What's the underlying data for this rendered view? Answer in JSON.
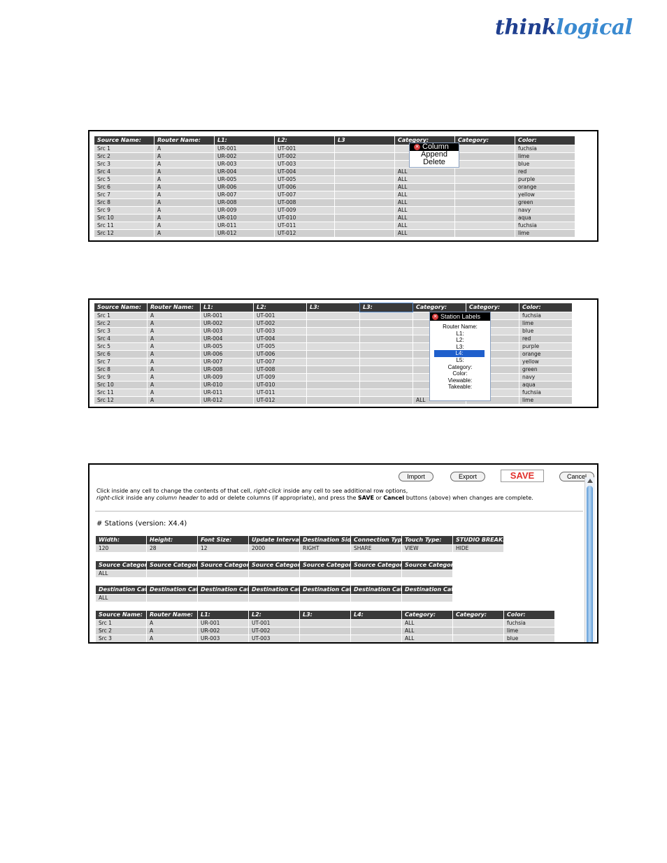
{
  "brand": {
    "part1": "think",
    "part2": "logical"
  },
  "screen1": {
    "headers": [
      "Source Name:",
      "Router Name:",
      "L1:",
      "L2:",
      "L3",
      "Category:",
      "Category:",
      "Color:"
    ],
    "rows": [
      [
        "Src 1",
        "A",
        "UR-001",
        "UT-001",
        "",
        "",
        "",
        "fuchsia"
      ],
      [
        "Src 2",
        "A",
        "UR-002",
        "UT-002",
        "",
        "",
        "",
        "lime"
      ],
      [
        "Src 3",
        "A",
        "UR-003",
        "UT-003",
        "",
        "",
        "",
        "blue"
      ],
      [
        "Src 4",
        "A",
        "UR-004",
        "UT-004",
        "",
        "ALL",
        "",
        "red"
      ],
      [
        "Src 5",
        "A",
        "UR-005",
        "UT-005",
        "",
        "ALL",
        "",
        "purple"
      ],
      [
        "Src 6",
        "A",
        "UR-006",
        "UT-006",
        "",
        "ALL",
        "",
        "orange"
      ],
      [
        "Src 7",
        "A",
        "UR-007",
        "UT-007",
        "",
        "ALL",
        "",
        "yellow"
      ],
      [
        "Src 8",
        "A",
        "UR-008",
        "UT-008",
        "",
        "ALL",
        "",
        "green"
      ],
      [
        "Src 9",
        "A",
        "UR-009",
        "UT-009",
        "",
        "ALL",
        "",
        "navy"
      ],
      [
        "Src 10",
        "A",
        "UR-010",
        "UT-010",
        "",
        "ALL",
        "",
        "aqua"
      ],
      [
        "Src 11",
        "A",
        "UR-011",
        "UT-011",
        "",
        "ALL",
        "",
        "fuchsia"
      ],
      [
        "Src 12",
        "A",
        "UR-012",
        "UT-012",
        "",
        "ALL",
        "",
        "lime"
      ]
    ],
    "context_menu": {
      "title": "Column",
      "items": [
        "Append",
        "Delete"
      ]
    }
  },
  "screen2": {
    "headers": [
      "Source Name:",
      "Router Name:",
      "L1:",
      "L2:",
      "L3:",
      "L3:",
      "Category:",
      "Category:",
      "Color:"
    ],
    "rows": [
      [
        "Src 1",
        "A",
        "UR-001",
        "UT-001",
        "",
        "",
        "",
        "",
        "fuchsia"
      ],
      [
        "Src 2",
        "A",
        "UR-002",
        "UT-002",
        "",
        "",
        "",
        "",
        "lime"
      ],
      [
        "Src 3",
        "A",
        "UR-003",
        "UT-003",
        "",
        "",
        "",
        "",
        "blue"
      ],
      [
        "Src 4",
        "A",
        "UR-004",
        "UT-004",
        "",
        "",
        "",
        "",
        "red"
      ],
      [
        "Src 5",
        "A",
        "UR-005",
        "UT-005",
        "",
        "",
        "",
        "",
        "purple"
      ],
      [
        "Src 6",
        "A",
        "UR-006",
        "UT-006",
        "",
        "",
        "",
        "",
        "orange"
      ],
      [
        "Src 7",
        "A",
        "UR-007",
        "UT-007",
        "",
        "",
        "",
        "",
        "yellow"
      ],
      [
        "Src 8",
        "A",
        "UR-008",
        "UT-008",
        "",
        "",
        "",
        "",
        "green"
      ],
      [
        "Src 9",
        "A",
        "UR-009",
        "UT-009",
        "",
        "",
        "",
        "",
        "navy"
      ],
      [
        "Src 10",
        "A",
        "UR-010",
        "UT-010",
        "",
        "",
        "",
        "",
        "aqua"
      ],
      [
        "Src 11",
        "A",
        "UR-011",
        "UT-011",
        "",
        "",
        "",
        "",
        "fuchsia"
      ],
      [
        "Src 12",
        "A",
        "UR-012",
        "UT-012",
        "",
        "",
        "ALL",
        "",
        "lime"
      ]
    ],
    "context_menu": {
      "title": "Station Labels",
      "items": [
        "Router Name:",
        "L1:",
        "L2:",
        "L3:",
        "L4:",
        "L5:",
        "Category:",
        "Color:",
        "Viewable:",
        "Takeable:"
      ],
      "selected": "L4:"
    }
  },
  "screen3": {
    "buttons": {
      "import": "Import",
      "export": "Export",
      "save": "SAVE",
      "cancel": "Cancel"
    },
    "instructions": {
      "l1a": "Click inside any cell to change the contents of that cell, ",
      "l1b": "right-click",
      "l1c": " inside any cell to see additional row options,",
      "l2a": "right-click",
      "l2b": " inside any ",
      "l2c": "column header",
      "l2d": " to add or delete columns (if appropriate), and press the ",
      "l2e": "SAVE",
      "l2f": " or ",
      "l2g": "Cancel",
      "l2h": " buttons (above) when changes are complete."
    },
    "stations_title": "# Stations (version: X4.4)",
    "settings": {
      "headers": [
        "Width:",
        "Height:",
        "Font Size:",
        "Update Interval:",
        "Destination Side:",
        "Connection Type:",
        "Touch Type:",
        "STUDIO BREAK:"
      ],
      "values": [
        "120",
        "28",
        "12",
        "2000",
        "RIGHT",
        "SHARE",
        "VIEW",
        "HIDE"
      ]
    },
    "source_categories": {
      "headers": [
        "Source Category:",
        "Source Category:",
        "Source Category:",
        "Source Category:",
        "Source Category:",
        "Source Category:",
        "Source Category:"
      ],
      "values": [
        "ALL",
        "",
        "",
        "",
        "",
        "",
        ""
      ]
    },
    "destination_categories": {
      "headers": [
        "Destination Category:",
        "Destination Category:",
        "Destination Category:",
        "Destination Category:",
        "Destination Category:",
        "Destination Category:",
        "Destination Category:"
      ],
      "values": [
        "ALL",
        "",
        "",
        "",
        "",
        "",
        ""
      ]
    },
    "sources": {
      "headers": [
        "Source Name:",
        "Router Name:",
        "L1:",
        "L2:",
        "L3:",
        "L4:",
        "Category:",
        "Category:",
        "Color:"
      ],
      "rows": [
        [
          "Src 1",
          "A",
          "UR-001",
          "UT-001",
          "",
          "",
          "ALL",
          "",
          "fuchsia"
        ],
        [
          "Src 2",
          "A",
          "UR-002",
          "UT-002",
          "",
          "",
          "ALL",
          "",
          "lime"
        ],
        [
          "Src 3",
          "A",
          "UR-003",
          "UT-003",
          "",
          "",
          "ALL",
          "",
          "blue"
        ]
      ]
    }
  }
}
